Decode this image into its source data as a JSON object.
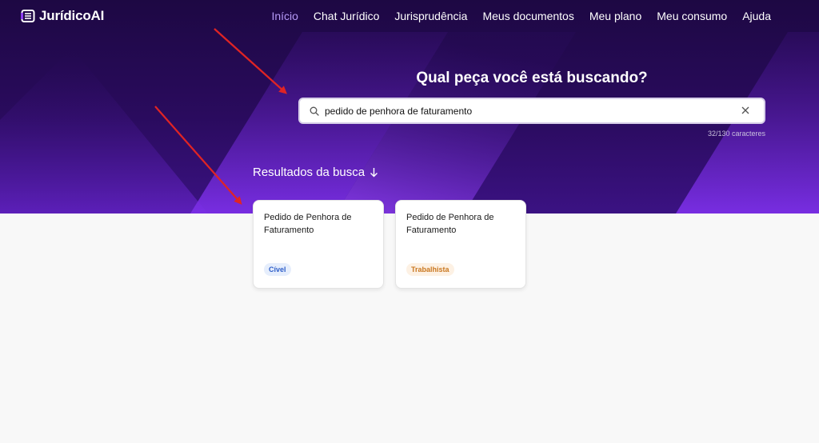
{
  "brand": {
    "name": "JurídicoAI",
    "icon": "document-lines-icon"
  },
  "nav": {
    "items": [
      {
        "label": "Início",
        "active": true
      },
      {
        "label": "Chat Jurídico"
      },
      {
        "label": "Jurisprudência"
      },
      {
        "label": "Meus documentos"
      },
      {
        "label": "Meu plano"
      },
      {
        "label": "Meu consumo"
      },
      {
        "label": "Ajuda"
      }
    ]
  },
  "hero": {
    "heading": "Qual peça você está buscando?"
  },
  "search": {
    "value": "pedido de penhora de faturamento",
    "counter": "32/130 caracteres",
    "icon": "search-icon",
    "clear_icon": "close-icon"
  },
  "results": {
    "title": "Resultados da busca",
    "icon": "arrow-down-icon",
    "cards": [
      {
        "title": "Pedido de Penhora de Faturamento",
        "badge": "Cível"
      },
      {
        "title": "Pedido de Penhora de Faturamento",
        "badge": "Trabalhista"
      }
    ]
  },
  "colors": {
    "hero_dark": "#1d0843",
    "hero_light": "#7b2fe6",
    "nav_active": "#b69af7",
    "annotation_arrow": "#e02424",
    "badge_civel": "#2f5fc9",
    "badge_trabalhista": "#c9771f"
  }
}
